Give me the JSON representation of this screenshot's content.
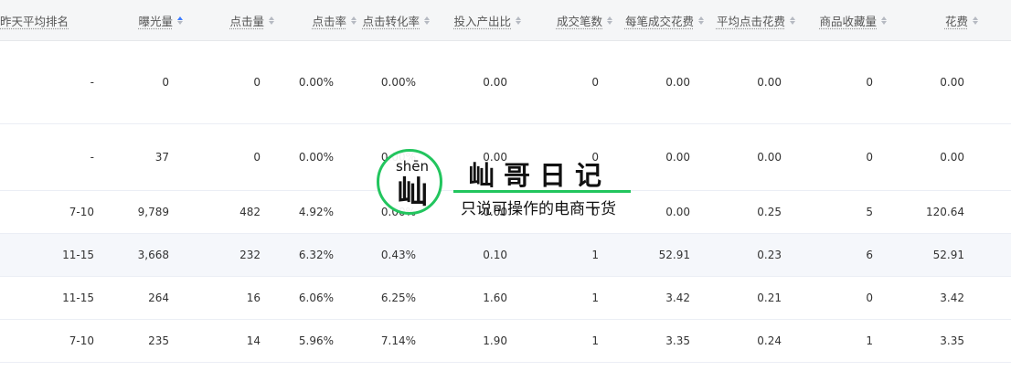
{
  "columns": [
    {
      "label": "昨天平均排名",
      "sortable": false
    },
    {
      "label": "曝光量",
      "sortable": true,
      "active": true
    },
    {
      "label": "点击量",
      "sortable": true
    },
    {
      "label": "点击率",
      "sortable": true
    },
    {
      "label": "点击转化率",
      "sortable": true
    },
    {
      "label": "投入产出比",
      "sortable": true
    },
    {
      "label": "成交笔数",
      "sortable": true
    },
    {
      "label": "每笔成交花费",
      "sortable": true
    },
    {
      "label": "平均点击花费",
      "sortable": true
    },
    {
      "label": "商品收藏量",
      "sortable": true
    },
    {
      "label": "花费",
      "sortable": true
    }
  ],
  "rows": [
    [
      "-",
      "0",
      "0",
      "0.00%",
      "0.00%",
      "0.00",
      "0",
      "0.00",
      "0.00",
      "0",
      "0.00"
    ],
    [
      "-",
      "37",
      "0",
      "0.00%",
      "0.00%",
      "0.00",
      "0",
      "0.00",
      "0.00",
      "0",
      "0.00"
    ],
    [
      "7-10",
      "9,789",
      "482",
      "4.92%",
      "0.00%",
      "0.00",
      "0",
      "0.00",
      "0.25",
      "5",
      "120.64"
    ],
    [
      "11-15",
      "3,668",
      "232",
      "6.32%",
      "0.43%",
      "0.10",
      "1",
      "52.91",
      "0.23",
      "6",
      "52.91"
    ],
    [
      "11-15",
      "264",
      "16",
      "6.06%",
      "6.25%",
      "1.60",
      "1",
      "3.42",
      "0.21",
      "0",
      "3.42"
    ],
    [
      "7-10",
      "235",
      "14",
      "5.96%",
      "7.14%",
      "1.90",
      "1",
      "3.35",
      "0.24",
      "1",
      "3.35"
    ]
  ],
  "watermark": {
    "pinyin": "shēn",
    "char": "屾",
    "title": "屾哥日记",
    "subtitle": "只说可操作的电商干货",
    "accent_color": "#22c55e"
  },
  "colors": {
    "header_bg": "#f5f6f7",
    "highlight_row_bg": "#f5f7fb",
    "sort_active": "#3b7bff"
  }
}
